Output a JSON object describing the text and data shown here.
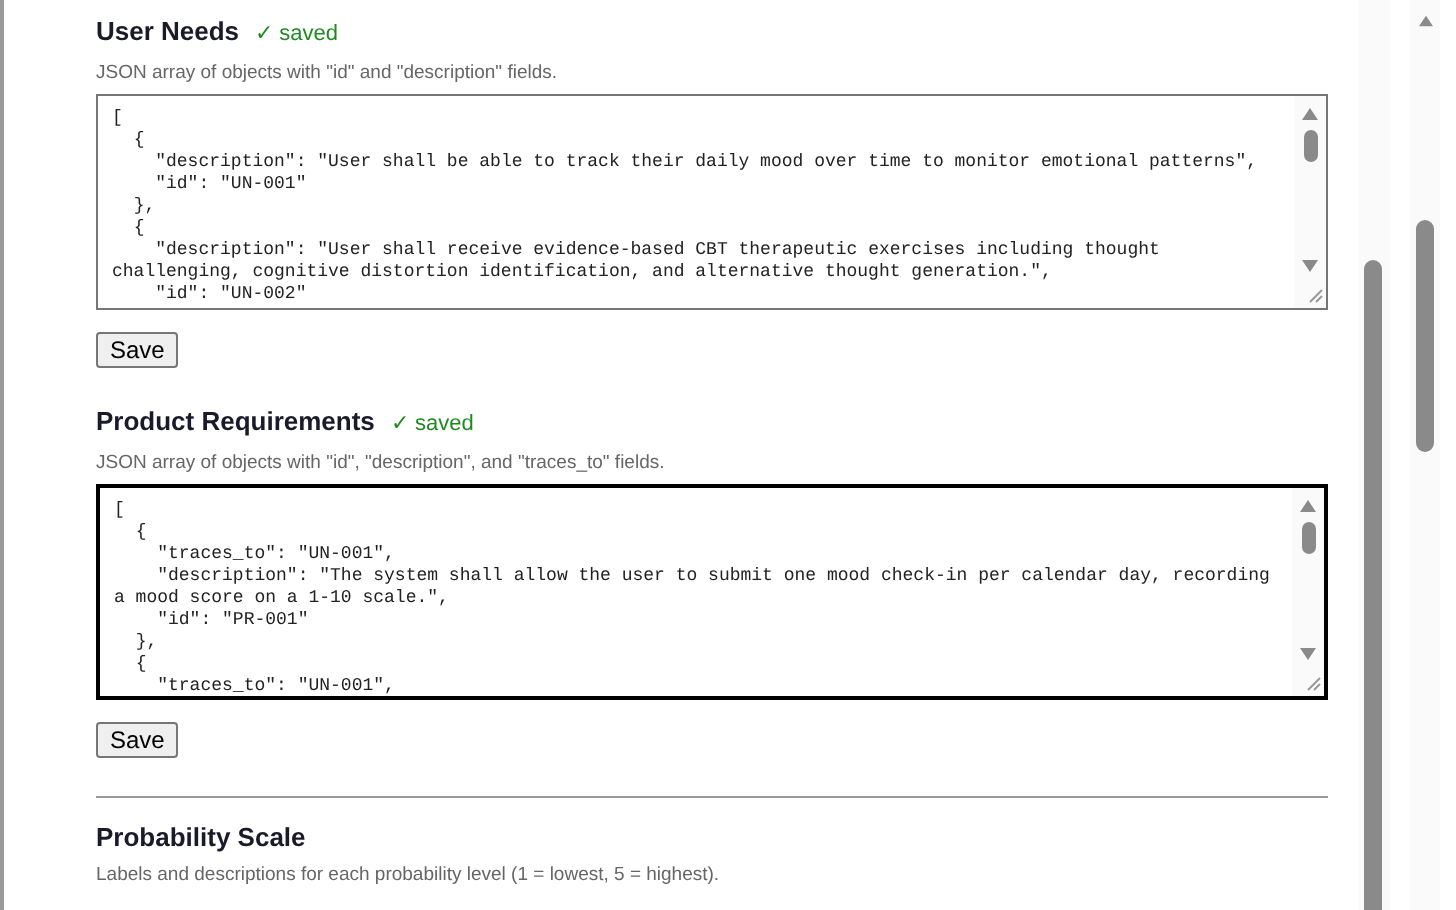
{
  "sections": [
    {
      "kind": "editor",
      "title": "User Needs",
      "status": "✓ saved",
      "hint": "JSON array of objects with \"id\" and \"description\" fields.",
      "focused": false,
      "value": "[\n  {\n    \"description\": \"User shall be able to track their daily mood over time to monitor emotional patterns\",\n    \"id\": \"UN-001\"\n  },\n  {\n    \"description\": \"User shall receive evidence-based CBT therapeutic exercises including thought challenging, cognitive distortion identification, and alternative thought generation.\",\n    \"id\": \"UN-002\"",
      "button": "Save"
    },
    {
      "kind": "editor",
      "title": "Product Requirements",
      "status": "✓ saved",
      "hint": "JSON array of objects with \"id\", \"description\", and \"traces_to\" fields.",
      "focused": true,
      "value": "[\n  {\n    \"traces_to\": \"UN-001\",\n    \"description\": \"The system shall allow the user to submit one mood check-in per calendar day, recording a mood score on a 1-10 scale.\",\n    \"id\": \"PR-001\"\n  },\n  {\n    \"traces_to\": \"UN-001\",",
      "button": "Save"
    },
    {
      "kind": "heading",
      "title": "Probability Scale",
      "hint": "Labels and descriptions for each probability level (1 = lowest, 5 = highest)."
    }
  ]
}
